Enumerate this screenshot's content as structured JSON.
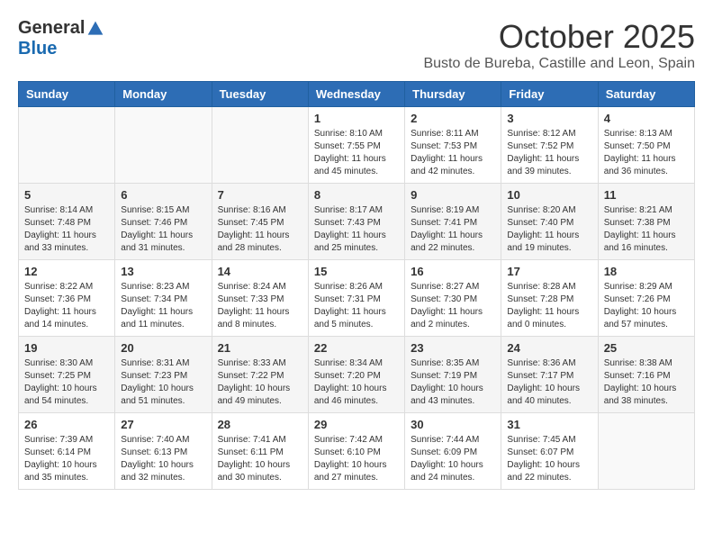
{
  "header": {
    "logo_general": "General",
    "logo_blue": "Blue",
    "month_title": "October 2025",
    "subtitle": "Busto de Bureba, Castille and Leon, Spain"
  },
  "calendar": {
    "days_of_week": [
      "Sunday",
      "Monday",
      "Tuesday",
      "Wednesday",
      "Thursday",
      "Friday",
      "Saturday"
    ],
    "weeks": [
      [
        {
          "day": "",
          "info": ""
        },
        {
          "day": "",
          "info": ""
        },
        {
          "day": "",
          "info": ""
        },
        {
          "day": "1",
          "info": "Sunrise: 8:10 AM\nSunset: 7:55 PM\nDaylight: 11 hours and 45 minutes."
        },
        {
          "day": "2",
          "info": "Sunrise: 8:11 AM\nSunset: 7:53 PM\nDaylight: 11 hours and 42 minutes."
        },
        {
          "day": "3",
          "info": "Sunrise: 8:12 AM\nSunset: 7:52 PM\nDaylight: 11 hours and 39 minutes."
        },
        {
          "day": "4",
          "info": "Sunrise: 8:13 AM\nSunset: 7:50 PM\nDaylight: 11 hours and 36 minutes."
        }
      ],
      [
        {
          "day": "5",
          "info": "Sunrise: 8:14 AM\nSunset: 7:48 PM\nDaylight: 11 hours and 33 minutes."
        },
        {
          "day": "6",
          "info": "Sunrise: 8:15 AM\nSunset: 7:46 PM\nDaylight: 11 hours and 31 minutes."
        },
        {
          "day": "7",
          "info": "Sunrise: 8:16 AM\nSunset: 7:45 PM\nDaylight: 11 hours and 28 minutes."
        },
        {
          "day": "8",
          "info": "Sunrise: 8:17 AM\nSunset: 7:43 PM\nDaylight: 11 hours and 25 minutes."
        },
        {
          "day": "9",
          "info": "Sunrise: 8:19 AM\nSunset: 7:41 PM\nDaylight: 11 hours and 22 minutes."
        },
        {
          "day": "10",
          "info": "Sunrise: 8:20 AM\nSunset: 7:40 PM\nDaylight: 11 hours and 19 minutes."
        },
        {
          "day": "11",
          "info": "Sunrise: 8:21 AM\nSunset: 7:38 PM\nDaylight: 11 hours and 16 minutes."
        }
      ],
      [
        {
          "day": "12",
          "info": "Sunrise: 8:22 AM\nSunset: 7:36 PM\nDaylight: 11 hours and 14 minutes."
        },
        {
          "day": "13",
          "info": "Sunrise: 8:23 AM\nSunset: 7:34 PM\nDaylight: 11 hours and 11 minutes."
        },
        {
          "day": "14",
          "info": "Sunrise: 8:24 AM\nSunset: 7:33 PM\nDaylight: 11 hours and 8 minutes."
        },
        {
          "day": "15",
          "info": "Sunrise: 8:26 AM\nSunset: 7:31 PM\nDaylight: 11 hours and 5 minutes."
        },
        {
          "day": "16",
          "info": "Sunrise: 8:27 AM\nSunset: 7:30 PM\nDaylight: 11 hours and 2 minutes."
        },
        {
          "day": "17",
          "info": "Sunrise: 8:28 AM\nSunset: 7:28 PM\nDaylight: 11 hours and 0 minutes."
        },
        {
          "day": "18",
          "info": "Sunrise: 8:29 AM\nSunset: 7:26 PM\nDaylight: 10 hours and 57 minutes."
        }
      ],
      [
        {
          "day": "19",
          "info": "Sunrise: 8:30 AM\nSunset: 7:25 PM\nDaylight: 10 hours and 54 minutes."
        },
        {
          "day": "20",
          "info": "Sunrise: 8:31 AM\nSunset: 7:23 PM\nDaylight: 10 hours and 51 minutes."
        },
        {
          "day": "21",
          "info": "Sunrise: 8:33 AM\nSunset: 7:22 PM\nDaylight: 10 hours and 49 minutes."
        },
        {
          "day": "22",
          "info": "Sunrise: 8:34 AM\nSunset: 7:20 PM\nDaylight: 10 hours and 46 minutes."
        },
        {
          "day": "23",
          "info": "Sunrise: 8:35 AM\nSunset: 7:19 PM\nDaylight: 10 hours and 43 minutes."
        },
        {
          "day": "24",
          "info": "Sunrise: 8:36 AM\nSunset: 7:17 PM\nDaylight: 10 hours and 40 minutes."
        },
        {
          "day": "25",
          "info": "Sunrise: 8:38 AM\nSunset: 7:16 PM\nDaylight: 10 hours and 38 minutes."
        }
      ],
      [
        {
          "day": "26",
          "info": "Sunrise: 7:39 AM\nSunset: 6:14 PM\nDaylight: 10 hours and 35 minutes."
        },
        {
          "day": "27",
          "info": "Sunrise: 7:40 AM\nSunset: 6:13 PM\nDaylight: 10 hours and 32 minutes."
        },
        {
          "day": "28",
          "info": "Sunrise: 7:41 AM\nSunset: 6:11 PM\nDaylight: 10 hours and 30 minutes."
        },
        {
          "day": "29",
          "info": "Sunrise: 7:42 AM\nSunset: 6:10 PM\nDaylight: 10 hours and 27 minutes."
        },
        {
          "day": "30",
          "info": "Sunrise: 7:44 AM\nSunset: 6:09 PM\nDaylight: 10 hours and 24 minutes."
        },
        {
          "day": "31",
          "info": "Sunrise: 7:45 AM\nSunset: 6:07 PM\nDaylight: 10 hours and 22 minutes."
        },
        {
          "day": "",
          "info": ""
        }
      ]
    ]
  }
}
